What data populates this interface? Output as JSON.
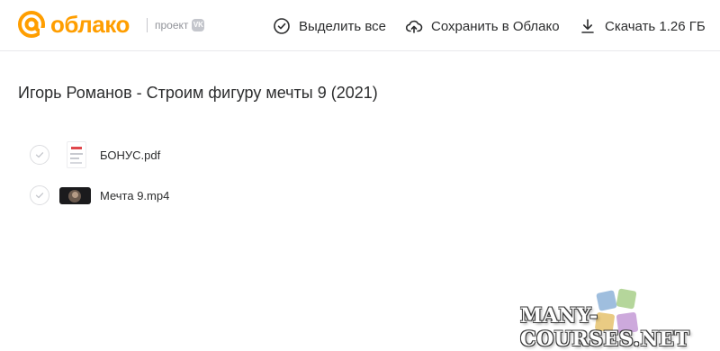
{
  "header": {
    "logo_text": "облако",
    "project_label": "проект",
    "vk_badge": "VK",
    "actions": {
      "select_all": "Выделить все",
      "save_to_cloud": "Сохранить в Облако",
      "download": "Скачать 1.26 ГБ"
    }
  },
  "folder": {
    "title": "Игорь Романов - Строим фигуру мечты 9 (2021)"
  },
  "files": [
    {
      "name": "БОНУС.pdf",
      "type": "pdf",
      "icon": "pdf-thumbnail"
    },
    {
      "name": "Мечта 9.mp4",
      "type": "video",
      "icon": "video-thumbnail"
    }
  ],
  "watermark": "MANY-COURSES.NET",
  "colors": {
    "brand": "#ff9e00",
    "text": "#2c2d2e",
    "muted": "#919399"
  }
}
